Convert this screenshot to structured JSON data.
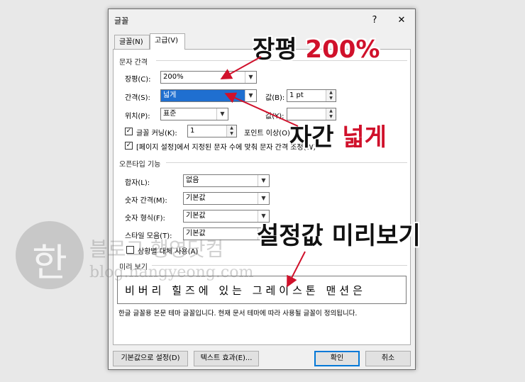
{
  "dialog": {
    "title": "글꼴",
    "help": "?",
    "close": "✕",
    "tabs": [
      {
        "label": "글꼴(N)"
      },
      {
        "label": "고급(V)"
      }
    ]
  },
  "spacing": {
    "heading": "문자 간격",
    "scale_label": "장평(C):",
    "scale_value": "200%",
    "spacing_label": "간격(S):",
    "spacing_value": "넓게",
    "by_label": "값(B):",
    "by_value": "1 pt",
    "position_label": "위치(P):",
    "position_value": "표준",
    "by2_label": "값(Y):",
    "by2_value": "",
    "kerning_label": "글꼴 커닝(K):",
    "kerning_value": "1",
    "kerning_suffix": "포인트 이상(O)",
    "grid_label": "[페이지 설정]에서 지정된 문자 수에 맞춰 문자 간격 조정(W)"
  },
  "opentype": {
    "heading": "오픈타입 기능",
    "ligatures_label": "합자(L):",
    "ligatures_value": "없음",
    "numspacing_label": "숫자 간격(M):",
    "numspacing_value": "기본값",
    "numforms_label": "숫자 형식(F):",
    "numforms_value": "기본값",
    "stylistic_label": "스타일 모음(T):",
    "stylistic_value": "기본값",
    "contextual_label": "상황별 대체 사용(A)"
  },
  "preview": {
    "heading": "미리 보기",
    "sample": "비버리 힐즈에 있는 그레이스톤 맨션은",
    "caption": "한글 글꼴용 본문 테마 글꼴입니다. 현재 문서 테마에 따라 사용될 글꼴이 정의됩니다."
  },
  "buttons": {
    "default": "기본값으로 설정(D)",
    "effects": "텍스트 효과(E)...",
    "ok": "확인",
    "cancel": "취소"
  },
  "annotations": {
    "scale_prefix": "장평 ",
    "scale_red": "200%",
    "spacing_prefix": "자간 ",
    "spacing_red": "넓게",
    "preview": "설정값 미리보기"
  },
  "watermark": {
    "logo": "한",
    "name": "블로그 행영닷컴",
    "url": "blog.hangyeong.com"
  },
  "colors": {
    "annotation_red": "#d0112b",
    "arrow": "#d0112b",
    "selection": "#1f6fd0",
    "primary_border": "#0078d7"
  },
  "icons": {
    "dropdown": "chevron-down-icon",
    "spin": "spin-updown-icon",
    "check": "checkmark-icon"
  }
}
